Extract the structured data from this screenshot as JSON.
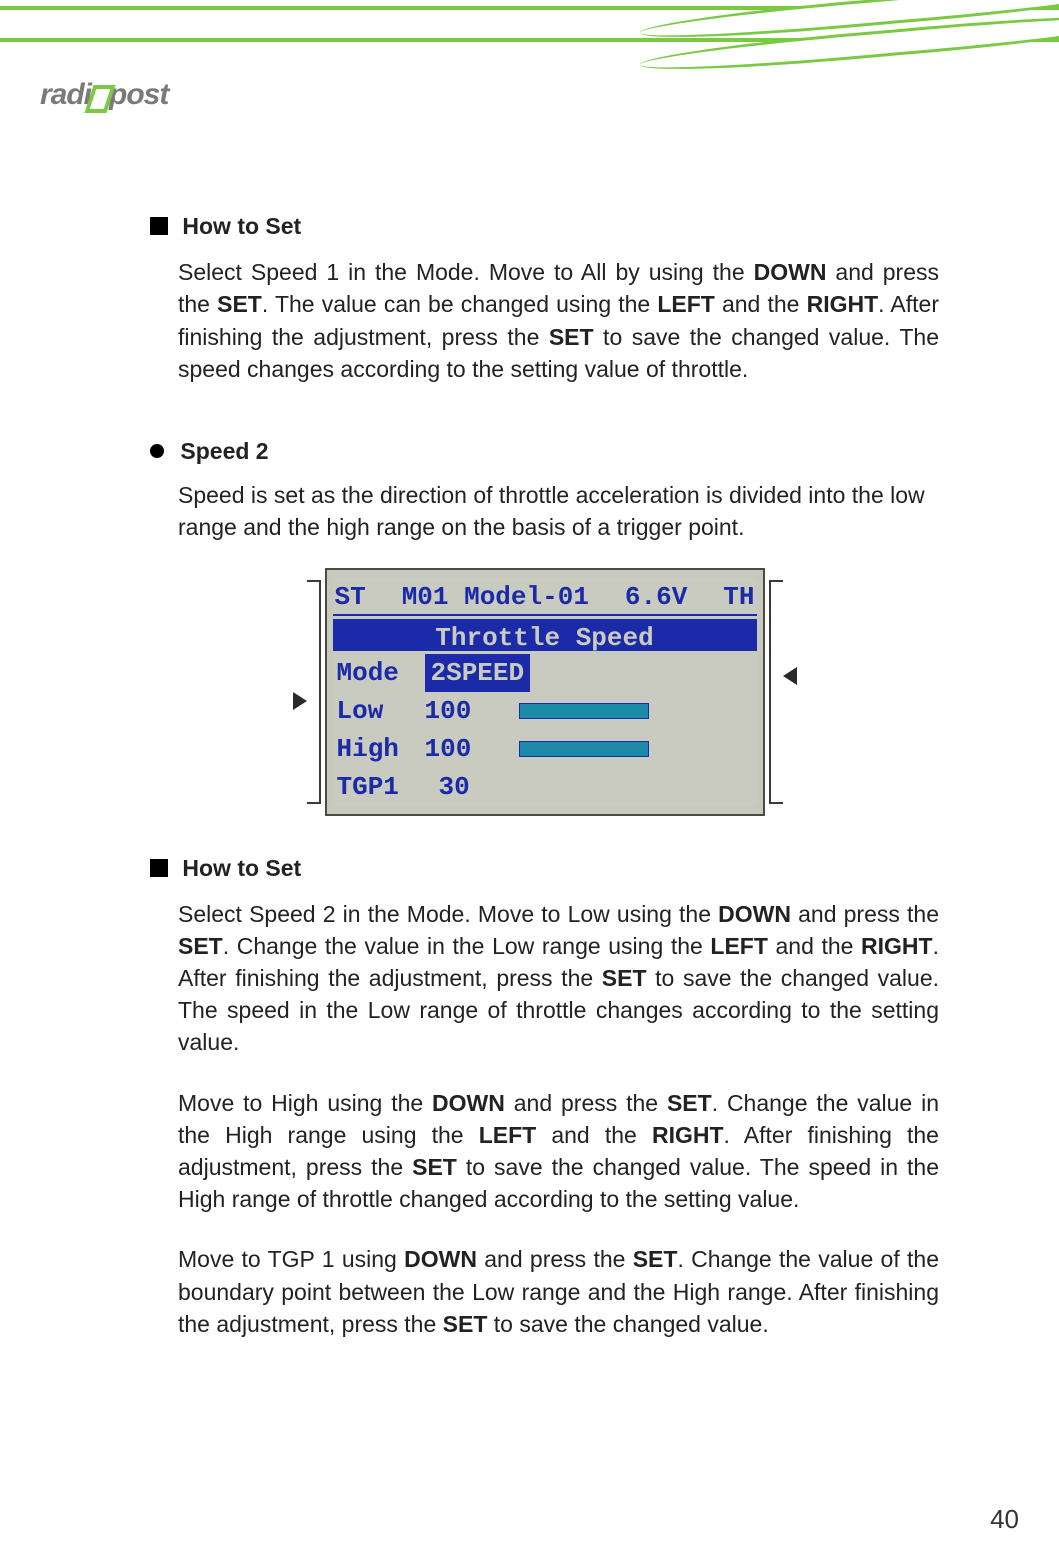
{
  "page_number": "40",
  "logo": {
    "brand_left": "radi",
    "brand_right": "post"
  },
  "section1": {
    "title": "How to Set",
    "body_parts": [
      "Select Speed 1 in the Mode. Move to All by using the ",
      "DOWN",
      " and press the ",
      "SET",
      ".  The value can be changed using the ",
      "LEFT",
      " and the ",
      "RIGHT",
      ". After finishing the adjustment, press the ",
      "SET",
      " to save the changed value.  The speed changes according to the setting value of throttle."
    ]
  },
  "speed2": {
    "title": "Speed 2",
    "desc": "Speed is set as the direction of throttle acceleration is divided into the low range and the high range on the basis of a trigger point."
  },
  "lcd": {
    "hdr_left": "ST",
    "hdr_mid": "M01 Model-01",
    "hdr_volt": "6.6V",
    "hdr_right": "TH",
    "subtitle": "Throttle Speed",
    "rows": {
      "mode": {
        "label": "Mode",
        "value": "2SPEED"
      },
      "low": {
        "label": "Low",
        "value": "100"
      },
      "high": {
        "label": "High",
        "value": "100"
      },
      "tgp": {
        "label": "TGP1",
        "value": "30"
      }
    }
  },
  "section2": {
    "title": "How to Set",
    "para1_parts": [
      "Select Speed 2 in the Mode.  Move to Low using the ",
      "DOWN",
      " and press the ",
      "SET",
      ".  Change the value in the Low range using the ",
      "LEFT",
      " and the ",
      "RIGHT",
      ".  After finishing the adjustment, press the ",
      "SET",
      " to save the changed value.  The speed in the Low range of throttle changes according to the setting value."
    ],
    "para2_parts": [
      "Move to High using the ",
      "DOWN",
      " and press the ",
      "SET",
      ".  Change the value in the High range using the ",
      "LEFT",
      " and the ",
      "RIGHT",
      ".  After finishing the adjustment, press the ",
      "SET",
      " to save the changed value.  The speed in the High range of throttle changed according to the setting value."
    ],
    "para3_parts": [
      "Move to TGP 1 using ",
      "DOWN",
      " and press the ",
      "SET",
      ".  Change the value of the boundary point between the Low range and the High range.  After finishing the adjustment, press the ",
      "SET",
      " to save the changed value."
    ]
  }
}
